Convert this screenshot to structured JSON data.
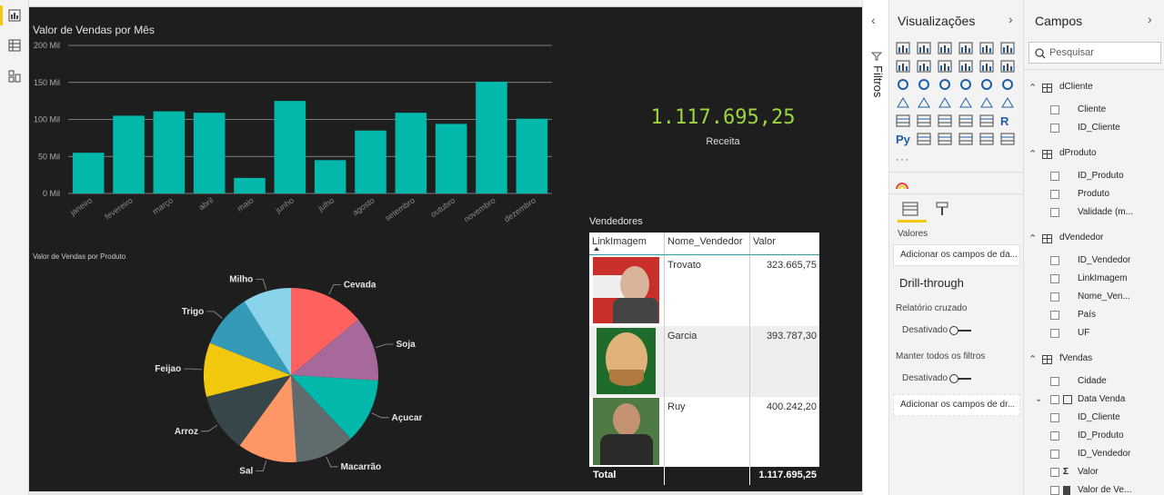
{
  "app": {
    "filters_label": "Filtros"
  },
  "left_nav": [
    "report-view",
    "data-view",
    "model-view"
  ],
  "bar_chart": {
    "title": "Valor de Vendas por Mês",
    "chart_data": {
      "type": "bar",
      "title": "Valor de Vendas por Mês",
      "categories": [
        "janeiro",
        "fevereiro",
        "março",
        "abril",
        "maio",
        "junho",
        "julho",
        "agosto",
        "setembro",
        "outubro",
        "novembro",
        "dezembro"
      ],
      "values": [
        55,
        105,
        111,
        109,
        21,
        125,
        45,
        85,
        109,
        94,
        151,
        101
      ],
      "y_ticks": [
        "0 Mil",
        "50 Mil",
        "100 Mil",
        "150 Mil",
        "200 Mil"
      ],
      "ylim": [
        0,
        200
      ],
      "grid": true,
      "color": "#01b8aa"
    }
  },
  "card": {
    "value": "1.117.695,25",
    "label": "Receita",
    "color": "#9bd63e"
  },
  "pie_chart": {
    "title": "Valor de Vendas por Produto",
    "chart_data": {
      "type": "pie",
      "labels": [
        "Cevada",
        "Soja",
        "Açucar",
        "Macarrão",
        "Sal",
        "Arroz",
        "Feijao",
        "Trigo",
        "Milho"
      ],
      "values": [
        14,
        12,
        12,
        11,
        11,
        11,
        10,
        10,
        9
      ],
      "colors": [
        "#fd625e",
        "#a66999",
        "#01b8aa",
        "#5f6b6d",
        "#fe9666",
        "#374649",
        "#f2c80f",
        "#3599b8",
        "#8ad4eb"
      ]
    }
  },
  "table": {
    "title": "Vendedores",
    "headers": [
      "LinkImagem",
      "Nome_Vendedor",
      "Valor"
    ],
    "rows": [
      {
        "name": "Trovato",
        "value": "323.665,75"
      },
      {
        "name": "Garcia",
        "value": "393.787,30"
      },
      {
        "name": "Ruy",
        "value": "400.242,20"
      }
    ],
    "total_label": "Total",
    "total_value": "1.117.695,25"
  },
  "visualizations": {
    "title": "Visualizações",
    "values_label": "Valores",
    "values_placeholder": "Adicionar os campos de da...",
    "drill_title": "Drill-through",
    "cross_report": "Relatório cruzado",
    "off1": "Desativado",
    "keep_filters": "Manter todos os filtros",
    "off2": "Desativado",
    "drill_placeholder": "Adicionar os campos de dr...",
    "more": "···",
    "r_label": "R",
    "py_label": "Py"
  },
  "fields": {
    "title": "Campos",
    "search_placeholder": "Pesquisar",
    "tables": [
      {
        "name": "dCliente",
        "fields": [
          "Cliente",
          "ID_Cliente"
        ]
      },
      {
        "name": "dProduto",
        "fields": [
          "ID_Produto",
          "Produto",
          "Validade (m..."
        ]
      },
      {
        "name": "dVendedor",
        "fields": [
          "ID_Vendedor",
          "LinkImagem",
          "Nome_Ven...",
          "País",
          "UF"
        ]
      },
      {
        "name": "fVendas",
        "fields": [
          "Cidade",
          "Data Venda",
          "ID_Cliente",
          "ID_Produto",
          "ID_Vendedor",
          "Valor",
          "Valor de Ve..."
        ]
      }
    ],
    "sigma": "Σ"
  }
}
